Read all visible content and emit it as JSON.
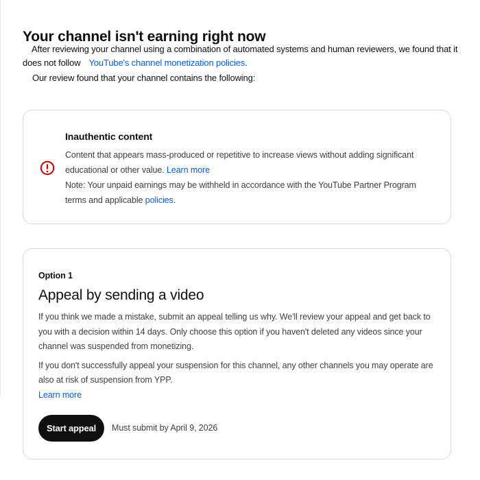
{
  "page": {
    "title": "Your channel isn't earning right now",
    "intro_text": "After reviewing your channel using a combination of automated systems and human reviewers, we found that it does not follow",
    "policy_link": "YouTube's channel monetization policies",
    "intro_end": ".",
    "review_text": "Our review found that your channel contains the following:"
  },
  "issue": {
    "icon": "alert-circle-icon",
    "icon_color": "#cc0000",
    "title": "Inauthentic content",
    "description": "Content that appears mass-produced or repetitive to increase views without adding significant educational or other value.",
    "learn_more": "Learn more",
    "note": "Note: Your unpaid earnings may be withheld in accordance with the YouTube Partner Program terms and applicable",
    "policies_link": "policies",
    "note_end": "."
  },
  "option": {
    "label": "Option 1",
    "title": "Appeal by sending a video",
    "paragraph1": "If you think we made a mistake, submit an appeal telling us why. We'll review your appeal and get back to you with a decision within 14 days. Only choose this option if you haven't deleted any videos since your channel was suspended from monetizing.",
    "paragraph2": "If you don't successfully appeal your suspension for this channel, any other channels you may operate are also at risk of suspension from YPP.",
    "learn_more": "Learn more",
    "button": "Start appeal",
    "deadline": "Must submit by April 9, 2026"
  },
  "colors": {
    "link": "#065fd4",
    "button_bg": "#0f0f0f",
    "button_text": "#ffffff",
    "card_border": "#d9d9d9"
  }
}
